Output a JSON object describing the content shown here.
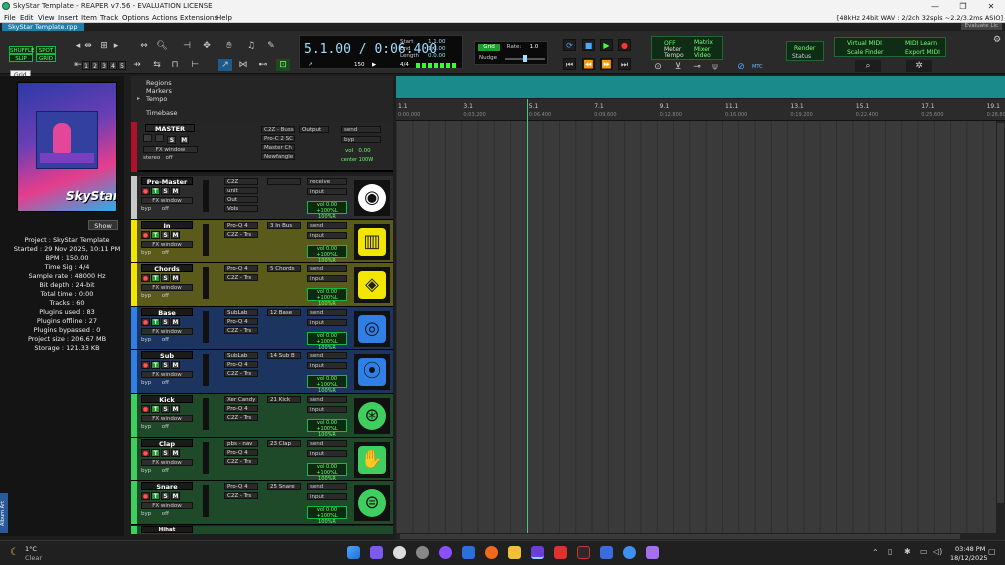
{
  "window": {
    "title": "SkyStar Template - REAPER v7.56 - EVALUATION LICENSE",
    "minimize": "—",
    "maximize": "❐",
    "close": "✕"
  },
  "menu": {
    "items": [
      "File",
      "Edit",
      "View",
      "Insert",
      "Item",
      "Track",
      "Options",
      "Actions",
      "Extensions",
      "Help"
    ],
    "audio_info": "[48kHz 24bit WAV : 2/2ch 32spls ~2.2/3.2ms ASIO]"
  },
  "tabs": {
    "active": "SkyStar Template.rpp"
  },
  "toolbar": {
    "shuffle": "SHUFFLE",
    "spot": "SPOT",
    "slip": "SLIP",
    "grid": "GRID",
    "nums": [
      "1",
      "2",
      "3",
      "4",
      "5"
    ],
    "time": "5.1.00 / 0:06.400",
    "start_label": "Start",
    "start_val": "1.1.00",
    "end_label": "End",
    "end_val": "1.1.00",
    "length_label": "Length",
    "length_val": "0.0.00",
    "bpm": "150",
    "timesig": "4/4",
    "grid_btn": "Grid",
    "rate_label": "Rate:",
    "rate_val": "1.0",
    "nudge": "Nudge",
    "off": "OFF",
    "meter": "Meter",
    "tempo": "Tempo",
    "matrix": "Matrix",
    "mixer": "Mixer",
    "video": "Video",
    "render": "Render",
    "status": "Status",
    "virtual_midi": "Virtual MIDI",
    "midi_learn": "MIDI Learn",
    "scale_finder": "Scale Finder",
    "export_midi": "Export MIDI",
    "mtc": "MTC",
    "evaluate": "Evaluate Lic"
  },
  "tooltip": "Grid",
  "project": {
    "show_label": "Show",
    "lines": [
      "Project : SkyStar Template",
      "Started : 29 Nov 2025, 10:11 PM",
      "BPM : 150.00",
      "Time Sig : 4/4",
      "Sample rate : 48000 Hz",
      "Bit depth : 24-bit",
      "Total time : 0:00",
      "Tracks : 60",
      "Plugins used : 83",
      "Plugins offline : 27",
      "Plugins bypassed : 0",
      "Project size : 206.67 MB",
      "Storage : 121.33 KB"
    ],
    "art_logo": "SkyStar"
  },
  "sidebar_tab": "Album Art",
  "folders": [
    "Regions",
    "Markers",
    "Tempo",
    "Timebase"
  ],
  "master": {
    "name": "MASTER",
    "fx_window": "FX window",
    "stereo": "stereo",
    "off": "off",
    "fx": [
      "C2Z - Buss",
      "Pro-C 2 SC",
      "Master Ch",
      "Newfangle"
    ],
    "output": "Output",
    "send": "send",
    "byp": "byp",
    "vol": "vol",
    "vol_val": "0.00",
    "center": "center 100W"
  },
  "tracks": [
    {
      "name": "Pre-Master",
      "color": "#c8c8c8",
      "bg": "#2c2c2c",
      "fx": [
        "C2Z",
        "unit",
        "Out",
        "Vols"
      ],
      "send": "",
      "io": "receive",
      "io2": "input",
      "icon": "vinyl-icon"
    },
    {
      "name": "In",
      "color": "#f2e600",
      "bg": "#5a5a1a",
      "fx": [
        "Pro-Q 4",
        "C2Z - Trs"
      ],
      "send": "3 In Bus",
      "io": "send",
      "io2": "input",
      "icon": "piano-icon"
    },
    {
      "name": "Chords",
      "color": "#f2e600",
      "bg": "#5a5a1a",
      "fx": [
        "Pro-Q 4",
        "C2Z - Trs"
      ],
      "send": "5 Chords",
      "io": "send",
      "io2": "input",
      "icon": "layers-icon"
    },
    {
      "name": "Base",
      "color": "#2f7fe6",
      "bg": "#1c3560",
      "fx": [
        "SubLab",
        "Pro-Q 4",
        "C2Z - Trs"
      ],
      "send": "12 Base",
      "io": "send",
      "io2": "input",
      "icon": "speaker-round-icon"
    },
    {
      "name": "Sub",
      "color": "#2f7fe6",
      "bg": "#1c3560",
      "fx": [
        "SubLab",
        "Pro-Q 4",
        "C2Z - Trs"
      ],
      "send": "14 Sub B",
      "io": "send",
      "io2": "input",
      "icon": "speaker-box-icon"
    },
    {
      "name": "Kick",
      "color": "#3fcf5f",
      "bg": "#1f4a2a",
      "fx": [
        "Xer Candy",
        "Pro-Q 4",
        "C2Z - Trs"
      ],
      "send": "21 Kick",
      "io": "send",
      "io2": "input",
      "icon": "kick-drum-icon"
    },
    {
      "name": "Clap",
      "color": "#3fcf5f",
      "bg": "#1f4a2a",
      "fx": [
        "pbs - nav",
        "Pro-Q 4",
        "C2Z - Trs"
      ],
      "send": "23 Clap",
      "io": "send",
      "io2": "input",
      "icon": "clap-hands-icon"
    },
    {
      "name": "Snare",
      "color": "#3fcf5f",
      "bg": "#1f4a2a",
      "fx": [
        "Pro-Q 4",
        "C2Z - Trs"
      ],
      "send": "25 Snare",
      "io": "send",
      "io2": "input",
      "icon": "snare-drum-icon"
    }
  ],
  "track_common": {
    "fx_window": "FX window",
    "byp": "byp",
    "off": "off",
    "vol": "vol",
    "vol_val": "0.00",
    "pan": "+100%L 100%R"
  },
  "partial_track": "Hihat",
  "ruler": {
    "bars": [
      "1.1",
      "3.1",
      "5.1",
      "7.1",
      "9.1",
      "11.1",
      "13.1",
      "15.1",
      "17.1",
      "19.1"
    ],
    "times": [
      "0:00.000",
      "0:03.200",
      "0:06.400",
      "0:09.600",
      "0:12.800",
      "0:16.000",
      "0:19.200",
      "0:22.400",
      "0:25.600",
      "0:28.800"
    ]
  },
  "taskbar": {
    "weather_temp": "1°C",
    "weather_desc": "Clear",
    "time": "03:48 PM",
    "date": "18/12/2025"
  }
}
